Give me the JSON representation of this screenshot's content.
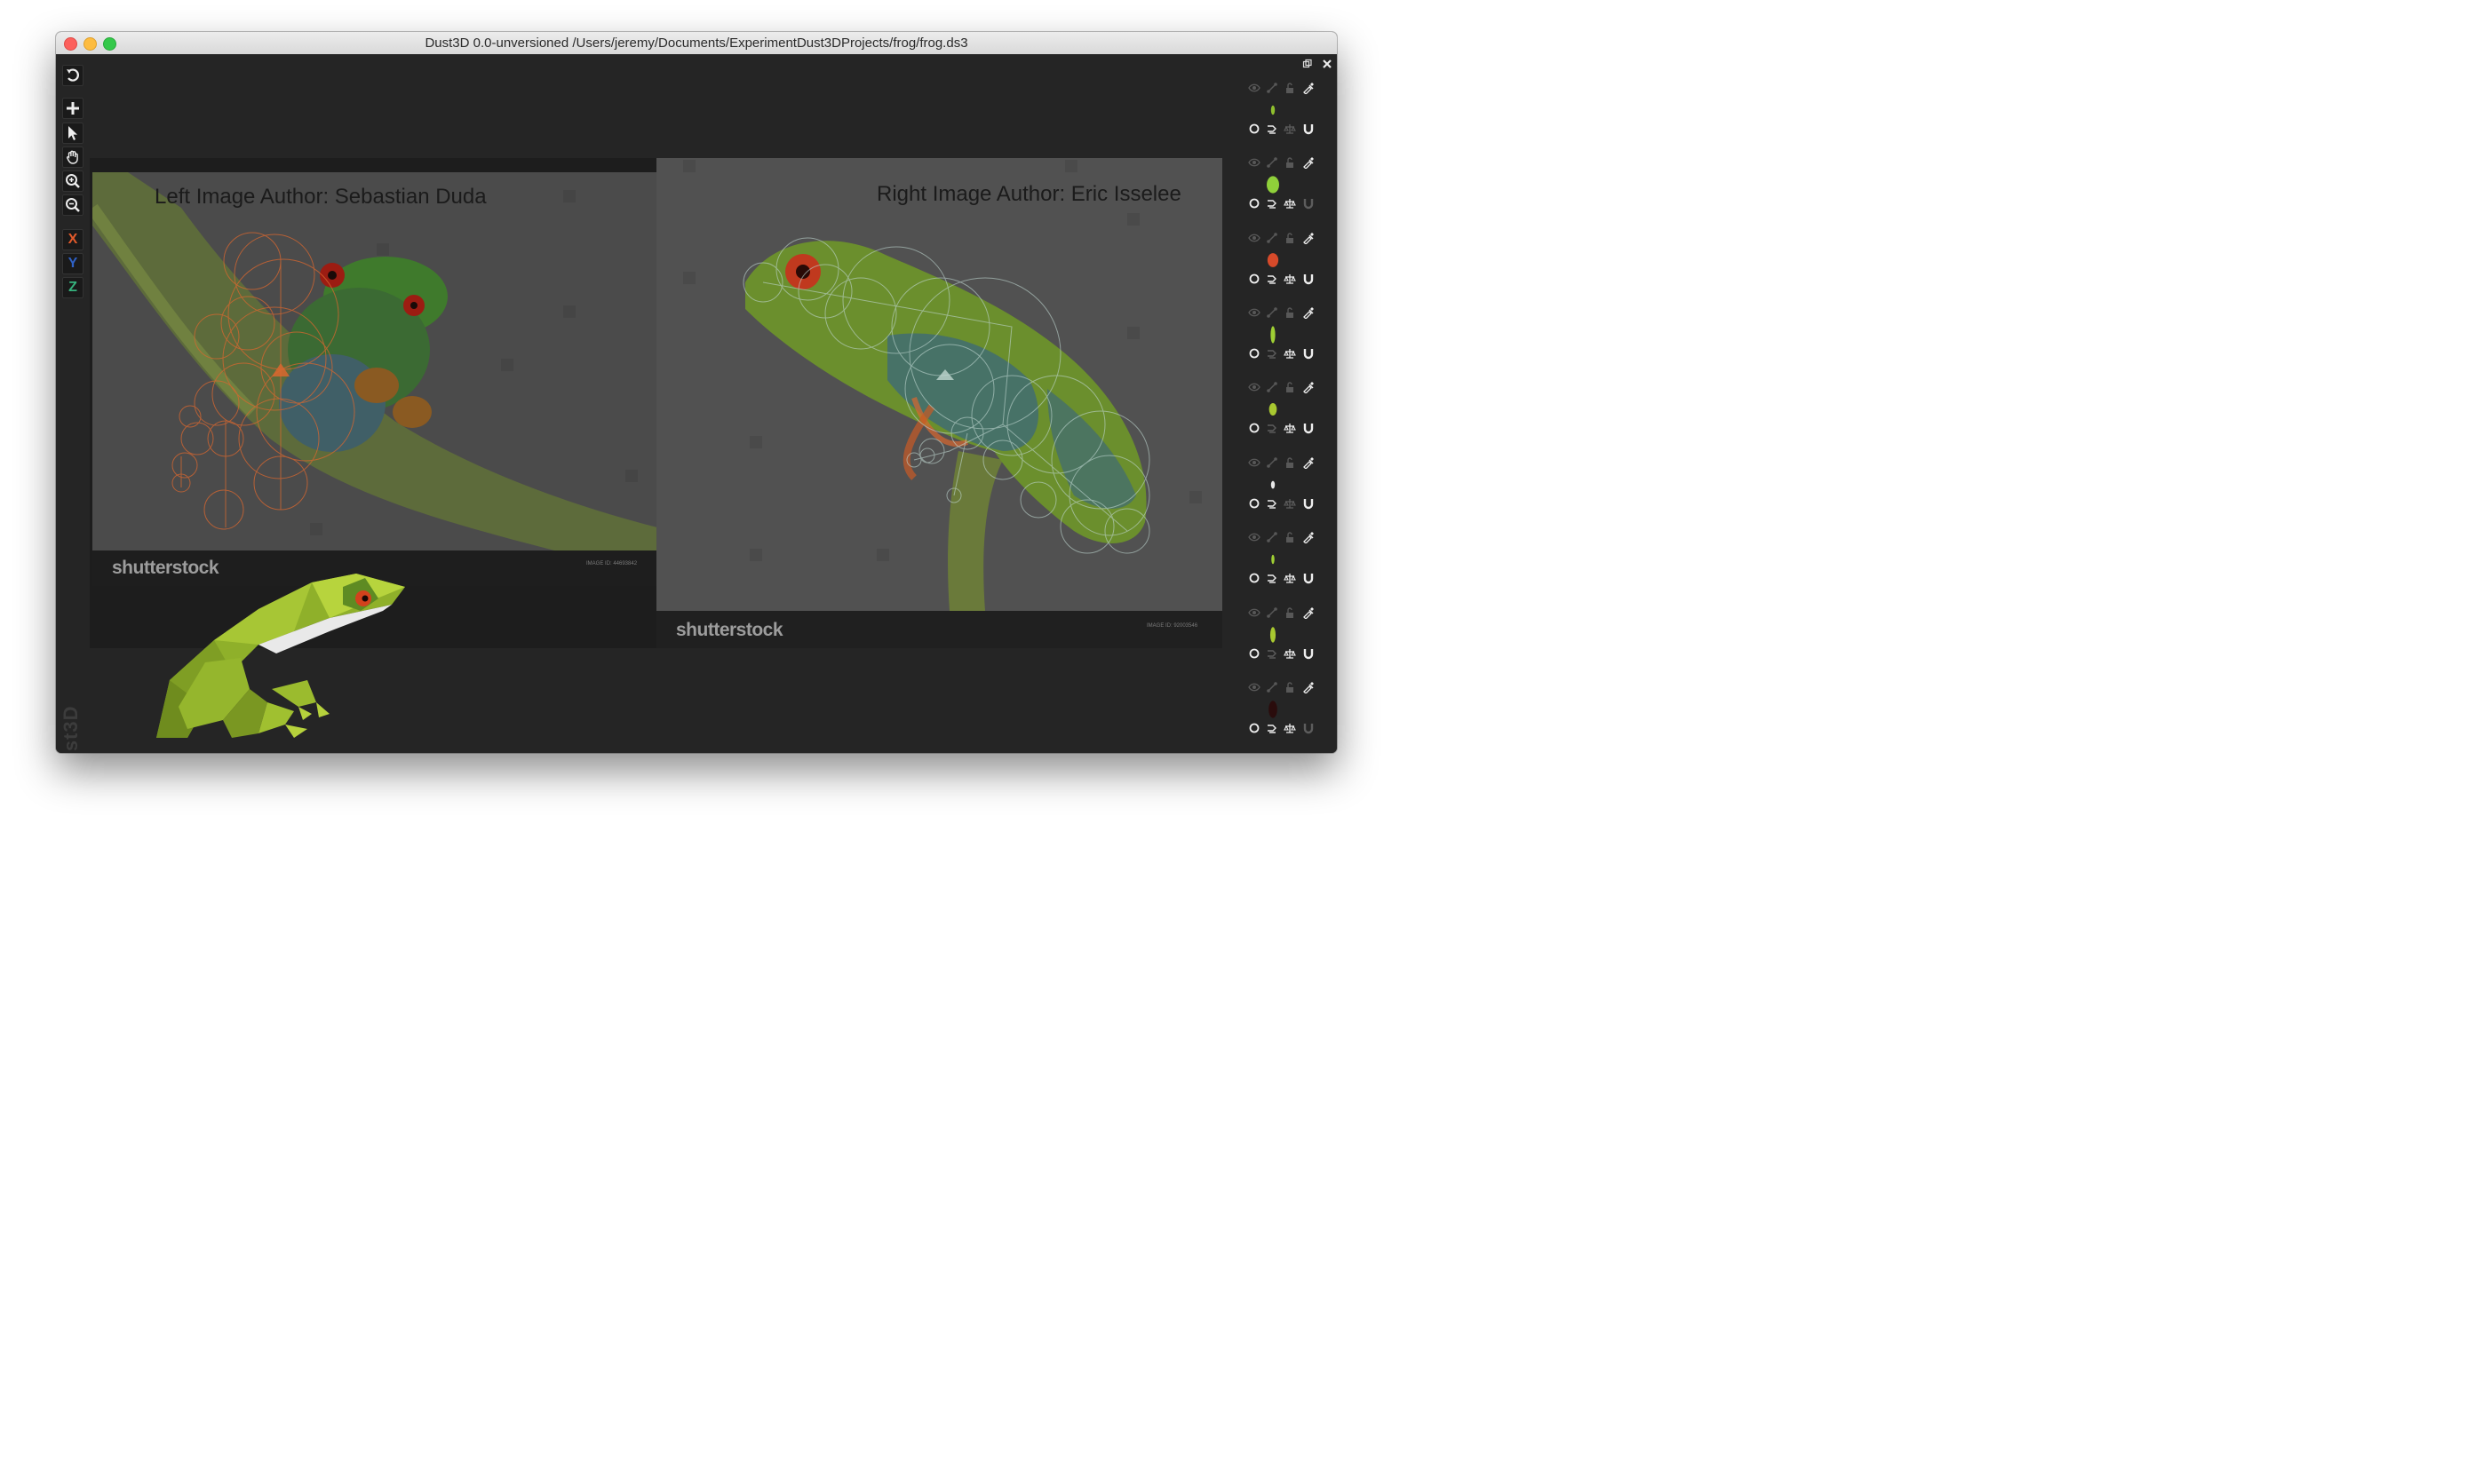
{
  "window": {
    "title": "Dust3D 0.0-unversioned /Users/jeremy/Documents/ExperimentDust3DProjects/frog/frog.ds3"
  },
  "toolbar": {
    "items": [
      {
        "name": "undo",
        "icon": "undo-icon"
      },
      {
        "name": "add",
        "icon": "plus-icon"
      },
      {
        "name": "select",
        "icon": "pointer-icon"
      },
      {
        "name": "drag",
        "icon": "hand-icon"
      },
      {
        "name": "zoom-in",
        "icon": "zoom-in-icon"
      },
      {
        "name": "zoom-out",
        "icon": "zoom-out-icon"
      }
    ],
    "axes": {
      "x": "X",
      "y": "Y",
      "z": "Z"
    },
    "axis_colors": {
      "x": "#e25a2b",
      "y": "#2f61c6",
      "z": "#36b37e"
    }
  },
  "brand": "Dust3D",
  "canvas": {
    "left_author": "Left Image Author:  Sebastian Duda",
    "right_author": "Right Image Author: Eric Isselee",
    "left_watermark": "shutterstock",
    "right_watermark": "shutterstock",
    "left_image_id": "IMAGE ID: 44693842",
    "right_image_id": "IMAGE ID: 92003546",
    "accent_left": "#d9672f",
    "accent_right": "#bfd6d0"
  },
  "parts_panel": {
    "parts": [
      {
        "color": "#8fbf2e",
        "visible_row": [
          0,
          0,
          0,
          1
        ],
        "bottom_row": [
          1,
          1,
          0,
          1
        ]
      },
      {
        "color": "#8fd03a",
        "visible_row": [
          0,
          0,
          0,
          1
        ],
        "bottom_row": [
          1,
          1,
          1,
          0
        ]
      },
      {
        "color": "#d74a2a",
        "visible_row": [
          0,
          0,
          0,
          1
        ],
        "bottom_row": [
          1,
          1,
          1,
          1
        ]
      },
      {
        "color": "#9fcf34",
        "visible_row": [
          0,
          0,
          0,
          1
        ],
        "bottom_row": [
          1,
          0,
          1,
          1
        ]
      },
      {
        "color": "#a8c830",
        "visible_row": [
          0,
          0,
          0,
          1
        ],
        "bottom_row": [
          1,
          0,
          1,
          1
        ]
      },
      {
        "color": "#e8e8e8",
        "visible_row": [
          0,
          0,
          0,
          1
        ],
        "bottom_row": [
          1,
          1,
          0,
          1
        ]
      },
      {
        "color": "#9fcf34",
        "visible_row": [
          0,
          0,
          0,
          1
        ],
        "bottom_row": [
          1,
          1,
          1,
          1
        ]
      },
      {
        "color": "#a8c830",
        "visible_row": [
          0,
          0,
          0,
          1
        ],
        "bottom_row": [
          1,
          0,
          1,
          1
        ]
      },
      {
        "color": "#2a0c0c",
        "visible_row": [
          0,
          0,
          0,
          1
        ],
        "bottom_row": [
          1,
          1,
          1,
          0
        ]
      }
    ]
  }
}
